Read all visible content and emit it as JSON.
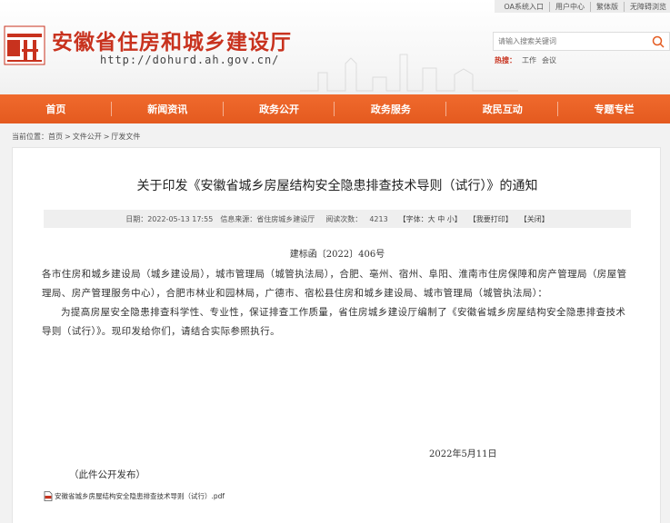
{
  "toplinks": [
    "OA系统入口",
    "用户中心",
    "繁体版",
    "无障碍浏览"
  ],
  "header": {
    "title": "安徽省住房和城乡建设厅",
    "url": "http://dohurd.ah.gov.cn/",
    "search_placeholder": "请输入搜索关键词",
    "hot_label": "热搜：",
    "hot_items": [
      "工作",
      "会议"
    ]
  },
  "nav": [
    "首页",
    "新闻资讯",
    "政务公开",
    "政务服务",
    "政民互动",
    "专题专栏"
  ],
  "breadcrumb": {
    "prefix": "当前位置：",
    "items": [
      "首页",
      "文件公开",
      "厅发文件"
    ],
    "sep": ">"
  },
  "article": {
    "title": "关于印发《安徽省城乡房屋结构安全隐患排查技术导则（试行）》的通知",
    "meta": {
      "date": "日期：2022-05-13 17:55",
      "source": "信息来源：省住房城乡建设厅",
      "views_label": "阅读次数：",
      "views": "4213",
      "font": "【字体：大 中 小】",
      "print": "【我要打印】",
      "close": "【关闭】"
    },
    "doc_no": "建标函〔2022〕406号",
    "recipients": "各市住房和城乡建设局（城乡建设局），城市管理局（城管执法局），合肥、亳州、宿州、阜阳、淮南市住房保障和房产管理局（房屋管理局、房产管理服务中心），合肥市林业和园林局，广德市、宿松县住房和城乡建设局、城市管理局（城管执法局）：",
    "paragraph": "为提高房屋安全隐患排查科学性、专业性，保证排查工作质量，省住房城乡建设厅编制了《安徽省城乡房屋结构安全隐患排查技术导则（试行）》。现印发给你们，请结合实际参照执行。",
    "date": "2022年5月11日",
    "publish_note": "（此件公开发布）",
    "attachment": "安徽省城乡房屋结构安全隐患排查技术导则（试行）.pdf"
  },
  "colors": {
    "brand_red": "#c8321e",
    "nav_orange": "#e45a1f"
  }
}
